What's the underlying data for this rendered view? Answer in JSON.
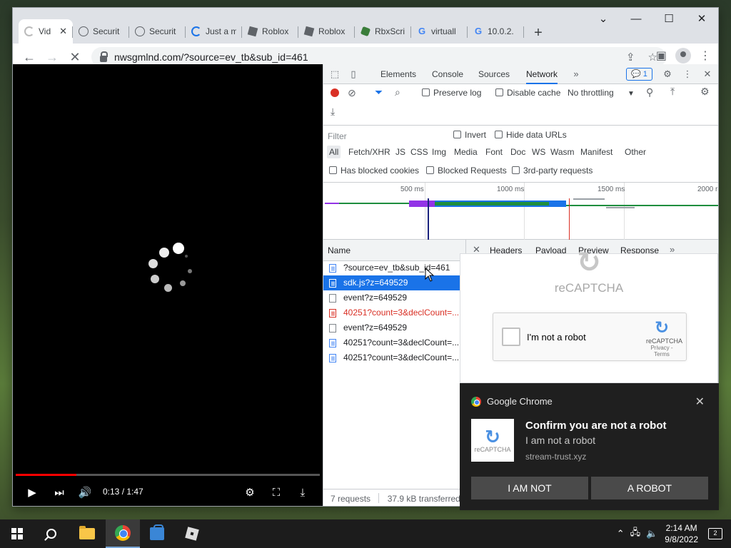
{
  "browser": {
    "tabs": [
      {
        "title": "Vid",
        "icon": "loading-spinner-icon",
        "active": true,
        "closable": true
      },
      {
        "title": "Securit",
        "icon": "globe-icon"
      },
      {
        "title": "Securit",
        "icon": "globe-icon"
      },
      {
        "title": "Just a m",
        "icon": "loading-spinner-icon"
      },
      {
        "title": "Roblox",
        "icon": "roblox-icon"
      },
      {
        "title": "Roblox",
        "icon": "roblox-icon"
      },
      {
        "title": "RbxScri",
        "icon": "rbxscripts-icon"
      },
      {
        "title": "virtuall",
        "icon": "google-icon"
      },
      {
        "title": "10.0.2.",
        "icon": "google-icon"
      }
    ],
    "new_tab_label": "+",
    "url": "nwsgmlnd.com/?source=ev_tb&sub_id=461"
  },
  "video": {
    "time": "0:13 / 1:47",
    "progress": 0.2
  },
  "devtools": {
    "tabs": [
      "Elements",
      "Console",
      "Sources",
      "Network"
    ],
    "active_tab": "Network",
    "message_count": "1",
    "toolbar": {
      "preserve_log": "Preserve log",
      "disable_cache": "Disable cache",
      "throttling": "No throttling"
    },
    "filter": {
      "placeholder": "Filter",
      "invert": "Invert",
      "hide_data_urls": "Hide data URLs",
      "types": [
        "All",
        "Fetch/XHR",
        "JS",
        "CSS",
        "Img",
        "Media",
        "Font",
        "Doc",
        "WS",
        "Wasm",
        "Manifest",
        "Other"
      ],
      "has_blocked_cookies": "Has blocked cookies",
      "blocked_requests": "Blocked Requests",
      "third_party": "3rd-party requests"
    },
    "timeline_ticks": [
      "500 ms",
      "1000 ms",
      "1500 ms",
      "2000 r"
    ],
    "name_header": "Name",
    "detail_tabs": [
      "Headers",
      "Payload",
      "Preview",
      "Response"
    ],
    "requests": [
      {
        "name": "?source=ev_tb&sub_id=461",
        "kind": "doc"
      },
      {
        "name": "sdk.js?z=649529",
        "kind": "doc",
        "selected": true
      },
      {
        "name": "event?z=649529",
        "kind": "plain"
      },
      {
        "name": "40251?count=3&declCount=...",
        "kind": "err",
        "error": true
      },
      {
        "name": "event?z=649529",
        "kind": "plain"
      },
      {
        "name": "40251?count=3&declCount=...",
        "kind": "doc"
      },
      {
        "name": "40251?count=3&declCount=...",
        "kind": "doc"
      }
    ],
    "status": {
      "requests": "7 requests",
      "transferred": "37.9 kB transferred"
    }
  },
  "captcha": {
    "title": "reCAPTCHA",
    "label": "I'm not a robot",
    "mini_text": "reCAPTCHA",
    "mini_terms": "Privacy - Terms"
  },
  "notification": {
    "app": "Google Chrome",
    "title": "Confirm you are not a robot",
    "body": "I am not a robot",
    "source": "stream-trust.xyz",
    "image_label": "reCAPTCHA",
    "buttons": [
      "I AM NOT",
      "A ROBOT"
    ]
  },
  "taskbar": {
    "time": "2:14 AM",
    "date": "9/8/2022",
    "notification_count": "2"
  }
}
